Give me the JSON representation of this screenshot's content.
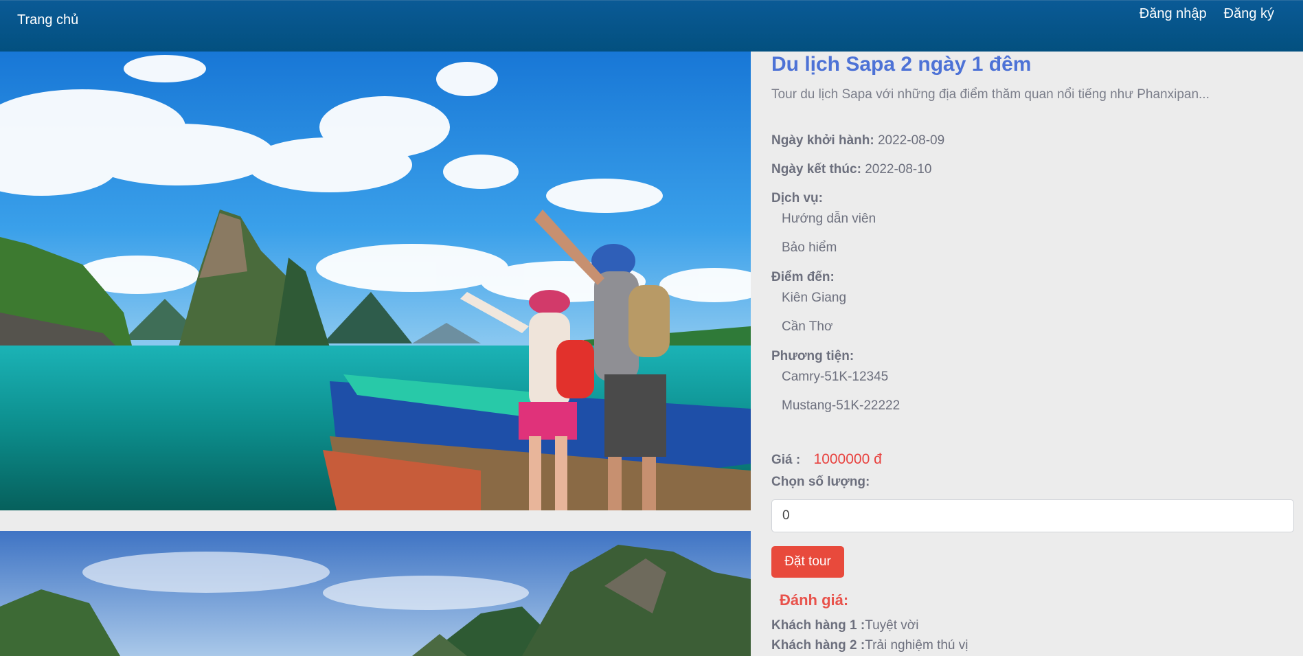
{
  "nav": {
    "home": "Trang chủ",
    "login": "Đăng nhập",
    "register": "Đăng ký"
  },
  "tour": {
    "title": "Du lịch Sapa 2 ngày 1 đêm",
    "description": "Tour du lịch Sapa với những địa điểm thăm quan nổi tiếng như Phanxipan...",
    "start_label": "Ngày khởi hành:",
    "start_date": "2022-08-09",
    "end_label": "Ngày kết thúc:",
    "end_date": "2022-08-10",
    "services_label": "Dịch vụ:",
    "services": [
      "Hướng dẫn viên",
      "Bảo hiểm"
    ],
    "destinations_label": "Điểm đến:",
    "destinations": [
      "Kiên Giang",
      "Cần Thơ"
    ],
    "vehicles_label": "Phương tiện:",
    "vehicles": [
      "Camry-51K-12345",
      "Mustang-51K-22222"
    ],
    "price_label": "Giá :",
    "price": "1000000 đ",
    "quantity_label": "Chọn số lượng:",
    "quantity_value": "0",
    "book_button": "Đặt tour"
  },
  "reviews": {
    "title": "Đánh giá:",
    "items": [
      {
        "customer": "Khách hàng 1 :",
        "comment": "Tuyệt vời"
      },
      {
        "customer": "Khách hàng 2 :",
        "comment": "Trải nghiệm thú vị"
      }
    ]
  }
}
